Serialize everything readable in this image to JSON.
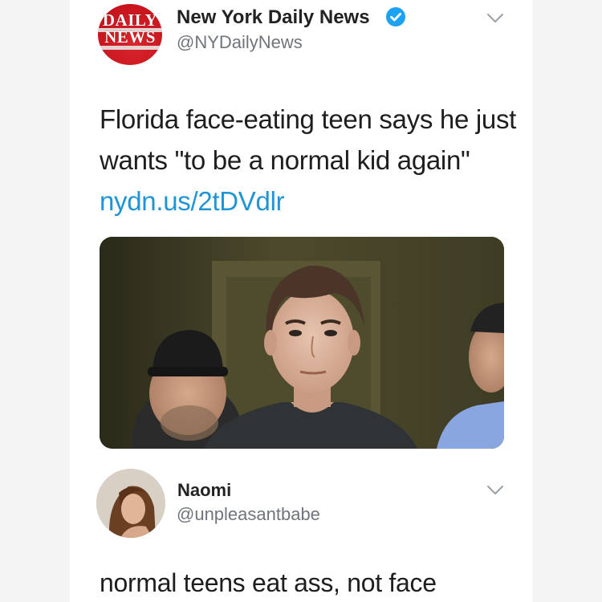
{
  "tweet": {
    "logo_line1": "DAILY",
    "logo_line2": "NEWS",
    "author_name": "New York Daily News",
    "author_handle": "@NYDailyNews",
    "text": "Florida face-eating teen says he just wants \"to be a normal kid again\" ",
    "link": "nydn.us/2tDVdlr",
    "verified_icon": "verified-badge-icon",
    "menu_icon": "chevron-down-icon"
  },
  "reply": {
    "author_name": "Naomi",
    "author_handle": "@unpleasantbabe",
    "text": "normal teens eat ass, not face",
    "menu_icon": "chevron-down-icon"
  },
  "colors": {
    "background": "#f4f4f4",
    "card": "#ffffff",
    "link": "#1f94d6",
    "verified": "#1da1f2",
    "logo_red": "#c8151d",
    "secondary_text": "#6f757b"
  }
}
